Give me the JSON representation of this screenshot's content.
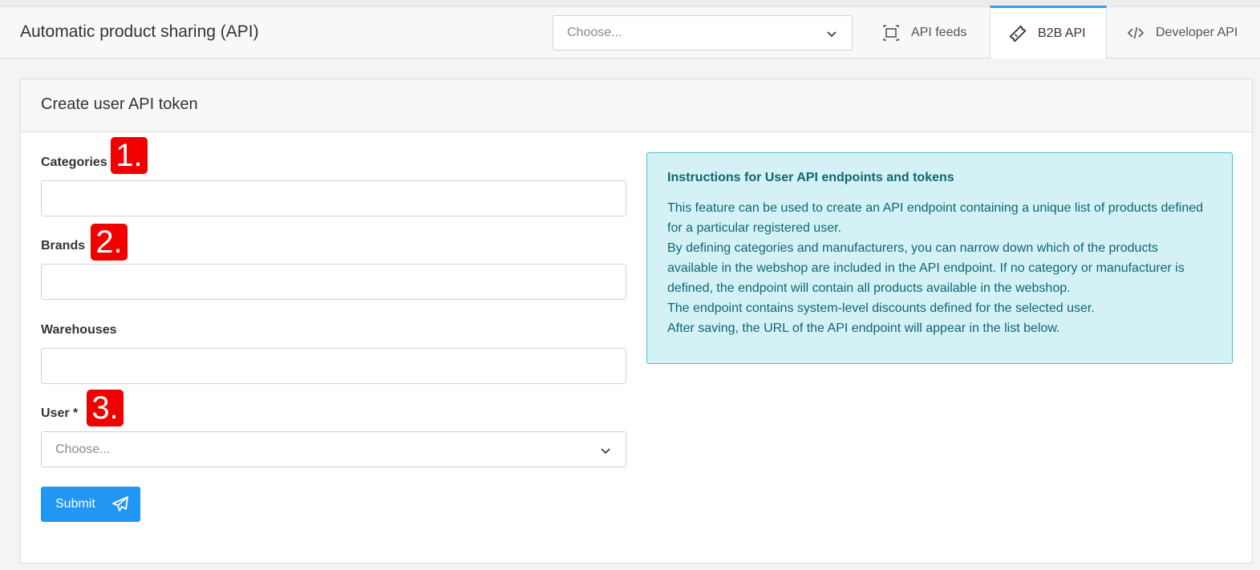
{
  "header": {
    "title": "Automatic product sharing (API)",
    "select_placeholder": "Choose...",
    "tabs": [
      {
        "label": "API feeds",
        "icon": "expand-icon"
      },
      {
        "label": "B2B API",
        "icon": "ticket-icon",
        "active": true
      },
      {
        "label": "Developer API",
        "icon": "code-icon"
      }
    ]
  },
  "card": {
    "title": "Create user API token",
    "fields": {
      "categories_label": "Categories",
      "brands_label": "Brands",
      "warehouses_label": "Warehouses",
      "user_label": "User *",
      "user_placeholder": "Choose..."
    },
    "submit_label": "Submit",
    "badges": [
      "1.",
      "2.",
      "3."
    ],
    "info": {
      "title": "Instructions for User API endpoints and tokens",
      "lines": [
        "This feature can be used to create an API endpoint containing a unique list of products defined",
        "for a particular registered user.",
        "By defining categories and manufacturers, you can narrow down which of the products",
        "available in the webshop are included in the API endpoint. If no category or manufacturer is",
        "defined, the endpoint will contain all products available in the webshop.",
        "The endpoint contains system-level discounts defined for the selected user.",
        "After saving, the URL of the API endpoint will appear in the list below."
      ]
    }
  },
  "colors": {
    "accent": "#2196f3",
    "tab_active_border": "#3c9ae8",
    "info_bg": "#d4f2f6",
    "info_border": "#42c1d4",
    "info_text": "#0f6674",
    "badge": "#f20000"
  }
}
